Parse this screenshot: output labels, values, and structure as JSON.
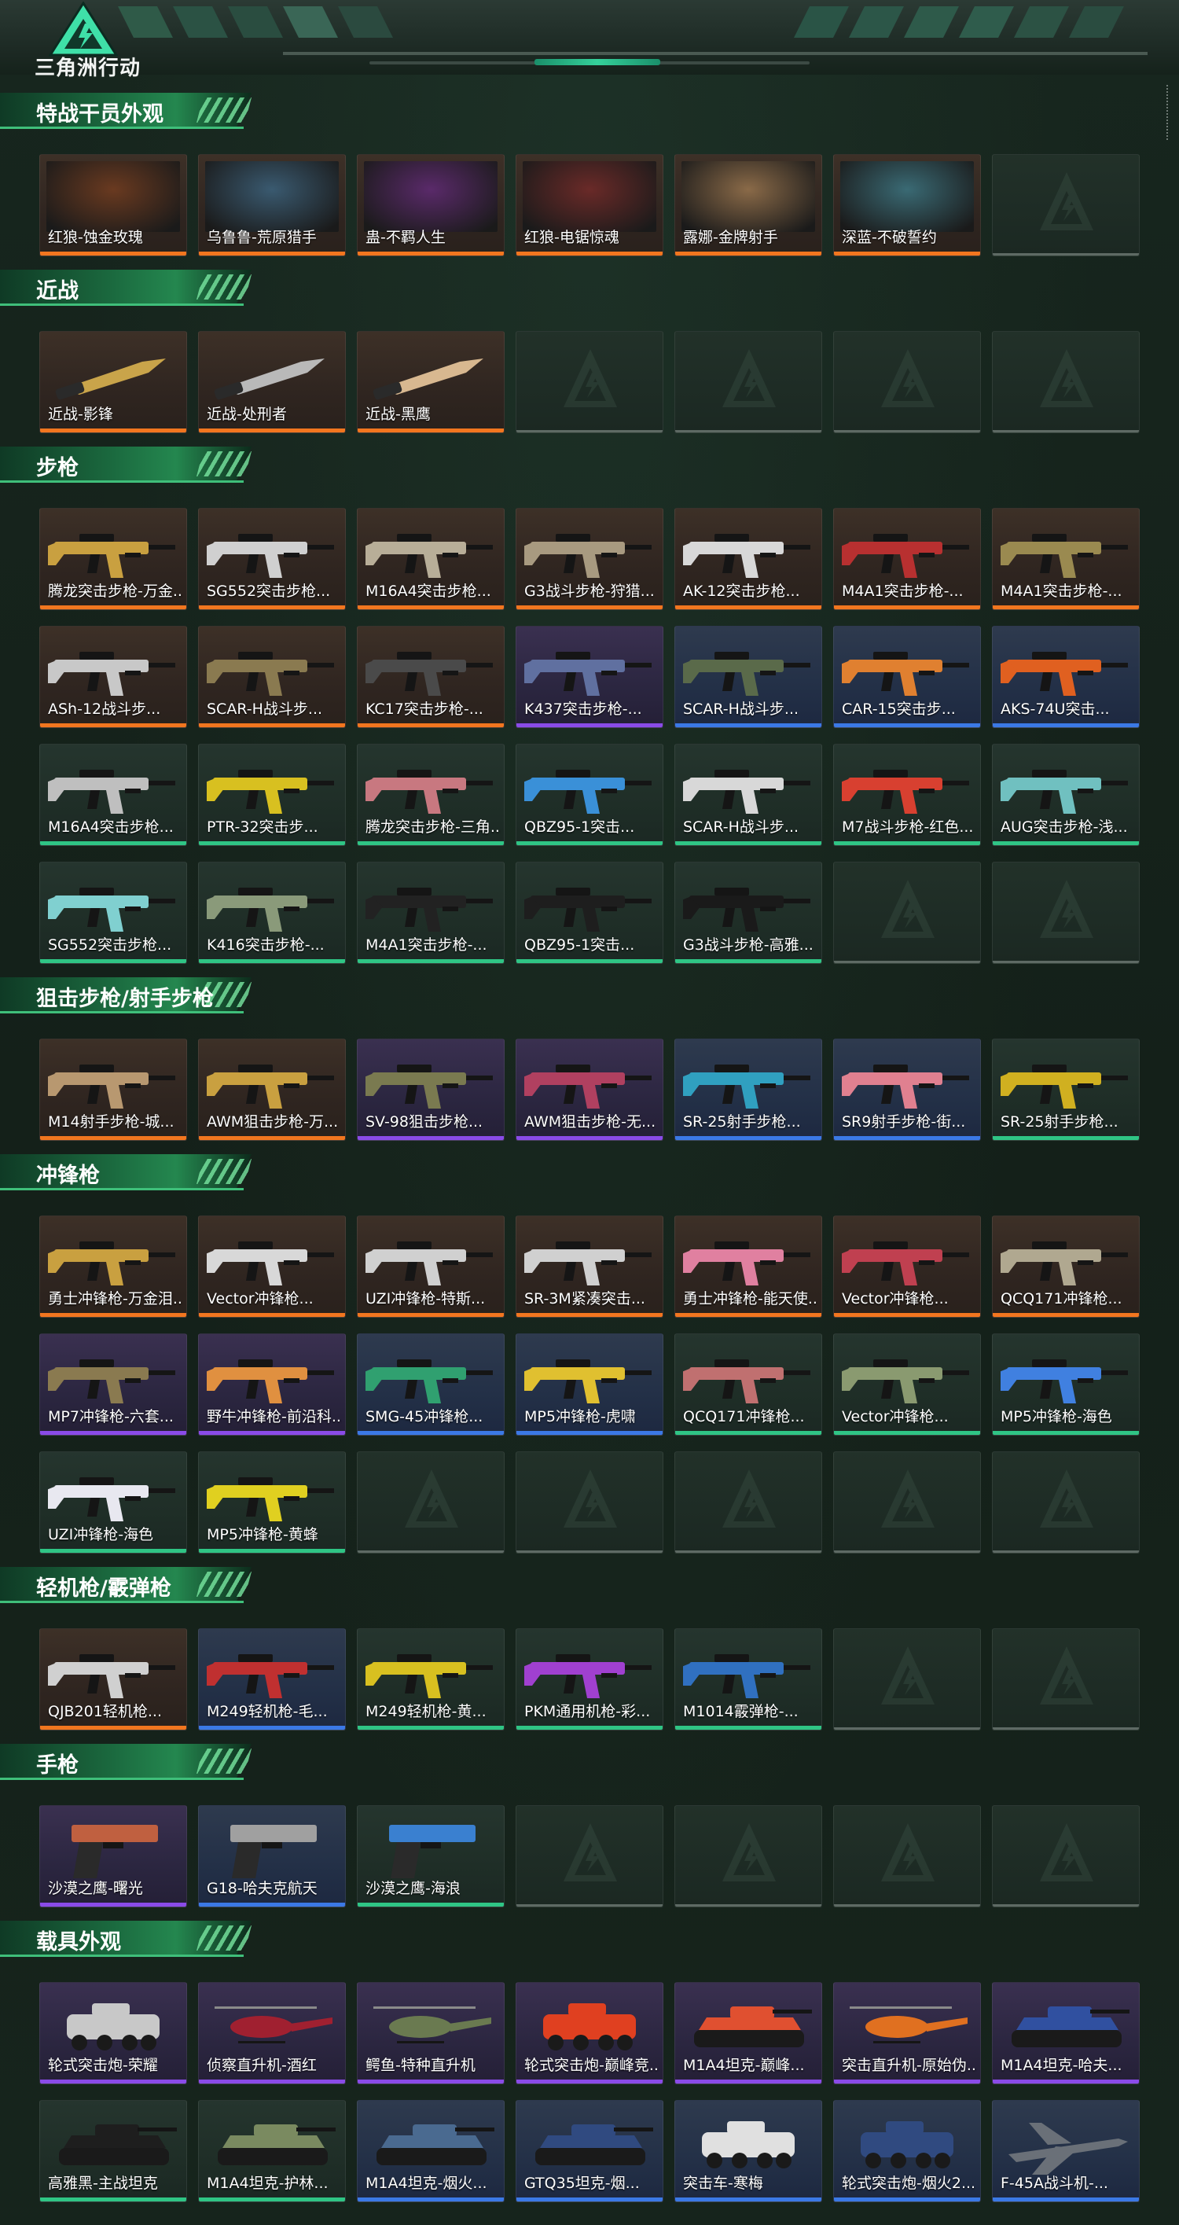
{
  "brand": {
    "logo_text": "三角洲行动"
  },
  "colors": {
    "gold": "#f2761f",
    "purple": "#8a4be8",
    "blue": "#3b79e6",
    "green": "#2fc585"
  },
  "sections": [
    {
      "title": "特战干员外观",
      "rows": [
        [
          {
            "name": "红狼-蚀金玫瑰",
            "rarity": "gold",
            "kind": "photo",
            "c": "#6a3a20"
          },
          {
            "name": "乌鲁鲁-荒原猎手",
            "rarity": "gold",
            "kind": "photo",
            "c": "#3a5a70"
          },
          {
            "name": "蛊-不羁人生",
            "rarity": "gold",
            "kind": "photo",
            "c": "#5a2a6a"
          },
          {
            "name": "红狼-电锯惊魂",
            "rarity": "gold",
            "kind": "photo",
            "c": "#6a2a28"
          },
          {
            "name": "露娜-金牌射手",
            "rarity": "gold",
            "kind": "photo",
            "c": "#8a6a48"
          },
          {
            "name": "深蓝-不破誓约",
            "rarity": "gold",
            "kind": "photo",
            "c": "#3a6a74"
          },
          null
        ]
      ]
    },
    {
      "title": "近战",
      "rows": [
        [
          {
            "name": "近战-影锋",
            "rarity": "gold",
            "kind": "knife",
            "c": "#c9a44a"
          },
          {
            "name": "近战-处刑者",
            "rarity": "gold",
            "kind": "knife",
            "c": "#b9b9b9"
          },
          {
            "name": "近战-黑鹰",
            "rarity": "gold",
            "kind": "knife",
            "c": "#d8b890"
          },
          null,
          null,
          null,
          null
        ]
      ]
    },
    {
      "title": "步枪",
      "rows": [
        [
          {
            "name": "腾龙突击步枪-万金...",
            "rarity": "gold",
            "kind": "gun",
            "c": "#c9a040"
          },
          {
            "name": "SG552突击步枪...",
            "rarity": "gold",
            "kind": "gun",
            "c": "#d0d0d0"
          },
          {
            "name": "M16A4突击步枪...",
            "rarity": "gold",
            "kind": "gun",
            "c": "#b8ae98"
          },
          {
            "name": "G3战斗步枪-狩猎...",
            "rarity": "gold",
            "kind": "gun",
            "c": "#a89a80"
          },
          {
            "name": "AK-12突击步枪...",
            "rarity": "gold",
            "kind": "gun",
            "c": "#d8d8d8"
          },
          {
            "name": "M4A1突击步枪-...",
            "rarity": "gold",
            "kind": "gun",
            "c": "#b83030"
          },
          {
            "name": "M4A1突击步枪-...",
            "rarity": "gold",
            "kind": "gun",
            "c": "#9a8a50"
          }
        ],
        [
          {
            "name": "ASh-12战斗步...",
            "rarity": "gold",
            "kind": "gun",
            "c": "#c8c8c8"
          },
          {
            "name": "SCAR-H战斗步...",
            "rarity": "gold",
            "kind": "gun",
            "c": "#8a7a50"
          },
          {
            "name": "KC17突击步枪-...",
            "rarity": "gold",
            "kind": "gun",
            "c": "#4a4a4a"
          },
          {
            "name": "K437突击步枪-...",
            "rarity": "purple",
            "kind": "gun",
            "c": "#6070a0"
          },
          {
            "name": "SCAR-H战斗步...",
            "rarity": "blue",
            "kind": "gun",
            "c": "#5a6a4a"
          },
          {
            "name": "CAR-15突击步...",
            "rarity": "blue",
            "kind": "gun",
            "c": "#e08030"
          },
          {
            "name": "AKS-74U突击...",
            "rarity": "blue",
            "kind": "gun",
            "c": "#e06020"
          }
        ],
        [
          {
            "name": "M16A4突击步枪...",
            "rarity": "green",
            "kind": "gun",
            "c": "#bfbfbf"
          },
          {
            "name": "PTR-32突击步...",
            "rarity": "green",
            "kind": "gun",
            "c": "#d8c020"
          },
          {
            "name": "腾龙突击步枪-三角...",
            "rarity": "green",
            "kind": "gun",
            "c": "#c87880"
          },
          {
            "name": "QBZ95-1突击...",
            "rarity": "green",
            "kind": "gun",
            "c": "#3a90d8"
          },
          {
            "name": "SCAR-H战斗步...",
            "rarity": "green",
            "kind": "gun",
            "c": "#d8d8d8"
          },
          {
            "name": "M7战斗步枪-红色...",
            "rarity": "green",
            "kind": "gun",
            "c": "#d84030"
          },
          {
            "name": "AUG突击步枪-浅...",
            "rarity": "green",
            "kind": "gun",
            "c": "#70c0c0"
          }
        ],
        [
          {
            "name": "SG552突击步枪...",
            "rarity": "green",
            "kind": "gun",
            "c": "#80d0d0"
          },
          {
            "name": "K416突击步枪-...",
            "rarity": "green",
            "kind": "gun",
            "c": "#8a9a7a"
          },
          {
            "name": "M4A1突击步枪-...",
            "rarity": "green",
            "kind": "gun",
            "c": "#222222"
          },
          {
            "name": "QBZ95-1突击...",
            "rarity": "green",
            "kind": "gun",
            "c": "#1e1e1e"
          },
          {
            "name": "G3战斗步枪-高雅...",
            "rarity": "green",
            "kind": "gun",
            "c": "#1a1a1a"
          },
          null,
          null
        ]
      ]
    },
    {
      "title": "狙击步枪/射手步枪",
      "rows": [
        [
          {
            "name": "M14射手步枪-城...",
            "rarity": "gold",
            "kind": "gun",
            "c": "#b89870"
          },
          {
            "name": "AWM狙击步枪-万...",
            "rarity": "gold",
            "kind": "gun",
            "c": "#c9a040"
          },
          {
            "name": "SV-98狙击步枪...",
            "rarity": "purple",
            "kind": "gun",
            "c": "#7a7a50"
          },
          {
            "name": "AWM狙击步枪-无...",
            "rarity": "purple",
            "kind": "gun",
            "c": "#b04060"
          },
          {
            "name": "SR-25射手步枪...",
            "rarity": "blue",
            "kind": "gun",
            "c": "#30a0c0"
          },
          {
            "name": "SR9射手步枪-街...",
            "rarity": "blue",
            "kind": "gun",
            "c": "#e08090"
          },
          {
            "name": "SR-25射手步枪...",
            "rarity": "green",
            "kind": "gun",
            "c": "#d0b020"
          }
        ]
      ]
    },
    {
      "title": "冲锋枪",
      "rows": [
        [
          {
            "name": "勇士冲锋枪-万金泪...",
            "rarity": "gold",
            "kind": "gun",
            "c": "#c9a040"
          },
          {
            "name": "Vector冲锋枪...",
            "rarity": "gold",
            "kind": "gun",
            "c": "#d8d8d8"
          },
          {
            "name": "UZI冲锋枪-特斯...",
            "rarity": "gold",
            "kind": "gun",
            "c": "#d0d0d0"
          },
          {
            "name": "SR-3M紧凑突击...",
            "rarity": "gold",
            "kind": "gun",
            "c": "#d0d0d0"
          },
          {
            "name": "勇士冲锋枪-能天使...",
            "rarity": "gold",
            "kind": "gun",
            "c": "#e080a0"
          },
          {
            "name": "Vector冲锋枪...",
            "rarity": "gold",
            "kind": "gun",
            "c": "#c04050"
          },
          {
            "name": "QCQ171冲锋枪...",
            "rarity": "gold",
            "kind": "gun",
            "c": "#b0a890"
          }
        ],
        [
          {
            "name": "MP7冲锋枪-六套...",
            "rarity": "purple",
            "kind": "gun",
            "c": "#8a7a50"
          },
          {
            "name": "野牛冲锋枪-前沿科...",
            "rarity": "purple",
            "kind": "gun",
            "c": "#e09040"
          },
          {
            "name": "SMG-45冲锋枪...",
            "rarity": "blue",
            "kind": "gun",
            "c": "#30a070"
          },
          {
            "name": "MP5冲锋枪-虎啸",
            "rarity": "blue",
            "kind": "gun",
            "c": "#e0c030"
          },
          {
            "name": "QCQ171冲锋枪...",
            "rarity": "green",
            "kind": "gun",
            "c": "#c07070"
          },
          {
            "name": "Vector冲锋枪...",
            "rarity": "green",
            "kind": "gun",
            "c": "#8a9a70"
          },
          {
            "name": "MP5冲锋枪-海色",
            "rarity": "green",
            "kind": "gun",
            "c": "#4080e0"
          }
        ],
        [
          {
            "name": "UZI冲锋枪-海色",
            "rarity": "green",
            "kind": "gun",
            "c": "#e8e8f0"
          },
          {
            "name": "MP5冲锋枪-黄蜂",
            "rarity": "green",
            "kind": "gun",
            "c": "#e0d020"
          },
          null,
          null,
          null,
          null,
          null
        ]
      ]
    },
    {
      "title": "轻机枪/霰弹枪",
      "rows": [
        [
          {
            "name": "QJB201轻机枪...",
            "rarity": "gold",
            "kind": "gun",
            "c": "#d0d0d0"
          },
          {
            "name": "M249轻机枪-毛...",
            "rarity": "blue",
            "kind": "gun",
            "c": "#c03030"
          },
          {
            "name": "M249轻机枪-黄...",
            "rarity": "green",
            "kind": "gun",
            "c": "#d8c020"
          },
          {
            "name": "PKM通用机枪-彩...",
            "rarity": "green",
            "kind": "gun",
            "c": "#a040d0"
          },
          {
            "name": "M1014霰弹枪-...",
            "rarity": "green",
            "kind": "gun",
            "c": "#3070c0"
          },
          null,
          null
        ]
      ]
    },
    {
      "title": "手枪",
      "rows": [
        [
          {
            "name": "沙漠之鹰-曙光",
            "rarity": "purple",
            "kind": "pistol",
            "c": "#c06040"
          },
          {
            "name": "G18-哈夫克航天",
            "rarity": "blue",
            "kind": "pistol",
            "c": "#a0a0a0"
          },
          {
            "name": "沙漠之鹰-海浪",
            "rarity": "green",
            "kind": "pistol",
            "c": "#3a80d0"
          },
          null,
          null,
          null,
          null
        ]
      ]
    },
    {
      "title": "载具外观",
      "rows": [
        [
          {
            "name": "轮式突击炮-荣耀",
            "rarity": "purple",
            "kind": "vehicle",
            "c": "#c8c8c8"
          },
          {
            "name": "侦察直升机-酒红",
            "rarity": "purple",
            "kind": "heli",
            "c": "#a02030"
          },
          {
            "name": "鳄鱼-特种直升机",
            "rarity": "purple",
            "kind": "heli",
            "c": "#6a7a50"
          },
          {
            "name": "轮式突击炮-巅峰竞...",
            "rarity": "purple",
            "kind": "vehicle",
            "c": "#e04020"
          },
          {
            "name": "M1A4坦克-巅峰...",
            "rarity": "purple",
            "kind": "tank",
            "c": "#e05030"
          },
          {
            "name": "突击直升机-原始伪...",
            "rarity": "purple",
            "kind": "heli",
            "c": "#e07020"
          },
          {
            "name": "M1A4坦克-哈夫...",
            "rarity": "purple",
            "kind": "tank",
            "c": "#3050a0"
          }
        ],
        [
          {
            "name": "高雅黑-主战坦克",
            "rarity": "green",
            "kind": "tank",
            "c": "#1e1e1e"
          },
          {
            "name": "M1A4坦克-护林...",
            "rarity": "green",
            "kind": "tank",
            "c": "#7a8a60"
          },
          {
            "name": "M1A4坦克-烟火...",
            "rarity": "blue",
            "kind": "tank",
            "c": "#4a6a90"
          },
          {
            "name": "GTQ35坦克-烟...",
            "rarity": "blue",
            "kind": "tank",
            "c": "#304a80"
          },
          {
            "name": "突击车-寒梅",
            "rarity": "blue",
            "kind": "vehicle",
            "c": "#e0e0e0"
          },
          {
            "name": "轮式突击炮-烟火2...",
            "rarity": "blue",
            "kind": "vehicle",
            "c": "#304a80"
          },
          {
            "name": "F-45A战斗机-...",
            "rarity": "blue",
            "kind": "jet",
            "c": "#6a7078"
          }
        ]
      ]
    }
  ]
}
